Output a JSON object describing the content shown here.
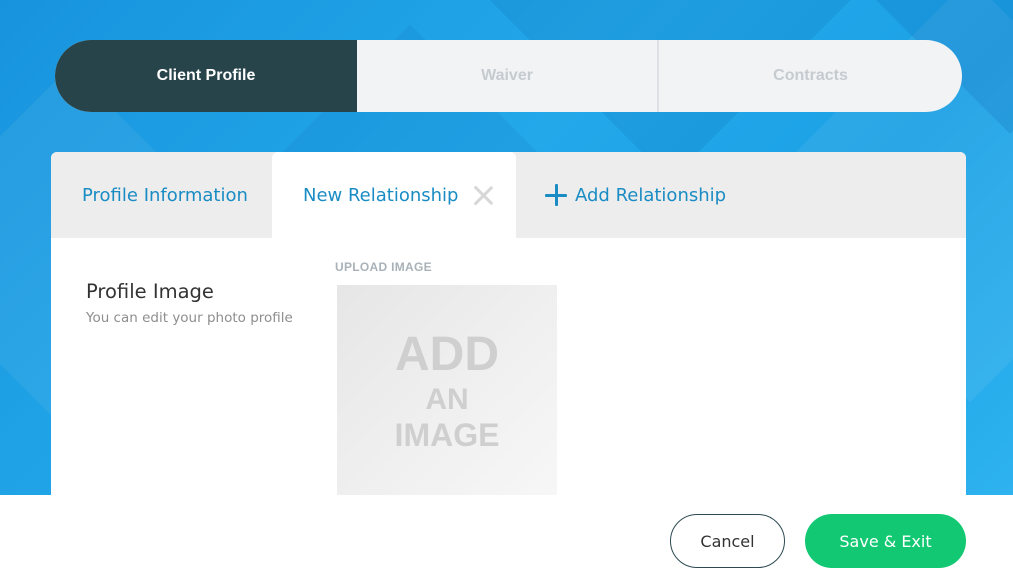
{
  "stepper": {
    "steps": [
      {
        "label": "Client Profile",
        "state": "active"
      },
      {
        "label": "Waiver",
        "state": "inactive"
      },
      {
        "label": "Contracts",
        "state": "inactive"
      }
    ]
  },
  "tabs": {
    "profile_information": "Profile Information",
    "new_relationship": "New Relationship",
    "add_relationship": "Add Relationship"
  },
  "profile_image": {
    "title": "Profile Image",
    "subtitle": "You can edit your photo profile",
    "upload_label": "UPLOAD IMAGE",
    "placeholder_lines": [
      "ADD",
      "AN",
      "IMAGE"
    ]
  },
  "footer": {
    "cancel_label": "Cancel",
    "save_label": "Save & Exit"
  },
  "icons": {
    "close": "close-icon",
    "plus": "plus-icon"
  },
  "colors": {
    "background": "#1ea3e6",
    "active_step": "#27444b",
    "tab_text": "#1a8cc4",
    "save_button": "#12c872"
  }
}
